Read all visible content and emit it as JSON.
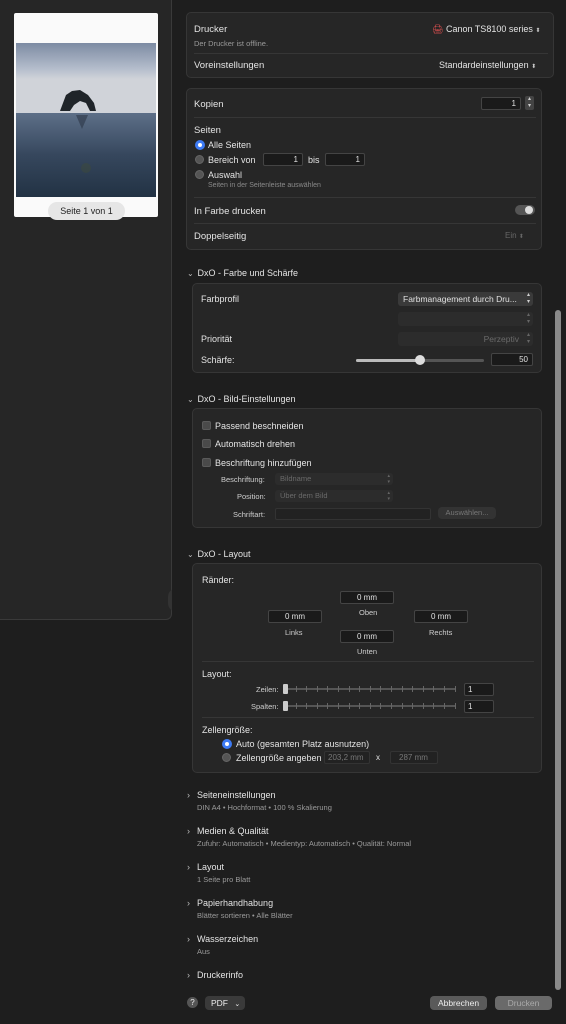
{
  "preview": {
    "page_label": "Seite 1 von 1"
  },
  "printer": {
    "label": "Drucker",
    "value": "Canon TS8100 series",
    "status": "Der Drucker ist offline."
  },
  "presets": {
    "label": "Voreinstellungen",
    "value": "Standardeinstellungen"
  },
  "copies": {
    "label": "Kopien",
    "value": "1"
  },
  "pages": {
    "label": "Seiten",
    "all": "Alle Seiten",
    "range": "Bereich von",
    "range_from": "1",
    "range_to_label": "bis",
    "range_to": "1",
    "selection": "Auswahl",
    "selection_hint": "Seiten in der Seitenleiste auswählen"
  },
  "color": {
    "label": "In Farbe drucken"
  },
  "duplex": {
    "label": "Doppelseitig",
    "value": "Ein"
  },
  "dxo_color": {
    "title": "DxO - Farbe und Schärfe",
    "profile_label": "Farbprofil",
    "profile_value": "Farbmanagement durch Dru...",
    "profile2_value": "",
    "priority_label": "Priorität",
    "priority_value": "Perzeptiv",
    "sharpness_label": "Schärfe:",
    "sharpness_value": "50",
    "sharpness_level": 0.5
  },
  "dxo_image": {
    "title": "DxO - Bild-Einstellungen",
    "crop": "Passend beschneiden",
    "rotate": "Automatisch drehen",
    "caption": "Beschriftung hinzufügen",
    "caption_label": "Beschriftung:",
    "caption_value": "Bildname",
    "position_label": "Position:",
    "position_value": "Über dem Bild",
    "font_label": "Schriftart:",
    "choose_button": "Auswählen..."
  },
  "dxo_layout": {
    "title": "DxO - Layout",
    "margins_label": "Ränder:",
    "top_value": "0 mm",
    "top_label": "Oben",
    "left_value": "0 mm",
    "left_label": "Links",
    "right_value": "0 mm",
    "right_label": "Rechts",
    "bottom_value": "0 mm",
    "bottom_label": "Unten",
    "layout_label": "Layout:",
    "rows_label": "Zeilen:",
    "rows_value": "1",
    "cols_label": "Spalten:",
    "cols_value": "1",
    "cellsize_label": "Zellengröße:",
    "auto": "Auto (gesamten Platz ausnutzen)",
    "specify": "Zellengröße angeben",
    "width_value": "203,2 mm",
    "times": "x",
    "height_value": "287 mm"
  },
  "sections": [
    {
      "title": "Seiteneinstellungen",
      "sub": "DIN A4 • Hochformat • 100 % Skalierung"
    },
    {
      "title": "Medien & Qualität",
      "sub": "Zufuhr: Automatisch • Medientyp: Automatisch • Qualität: Normal"
    },
    {
      "title": "Layout",
      "sub": "1 Seite pro Blatt"
    },
    {
      "title": "Papierhandhabung",
      "sub": "Blätter sortieren • Alle Blätter"
    },
    {
      "title": "Wasserzeichen",
      "sub": "Aus"
    },
    {
      "title": "Druckerinfo",
      "sub": ""
    }
  ],
  "footer": {
    "help": "?",
    "pdf": "PDF",
    "cancel": "Abbrechen",
    "print": "Drucken"
  },
  "colors": {
    "accent": "#3d7bf5",
    "bg": "#1e1e1e",
    "panel": "#262626"
  }
}
